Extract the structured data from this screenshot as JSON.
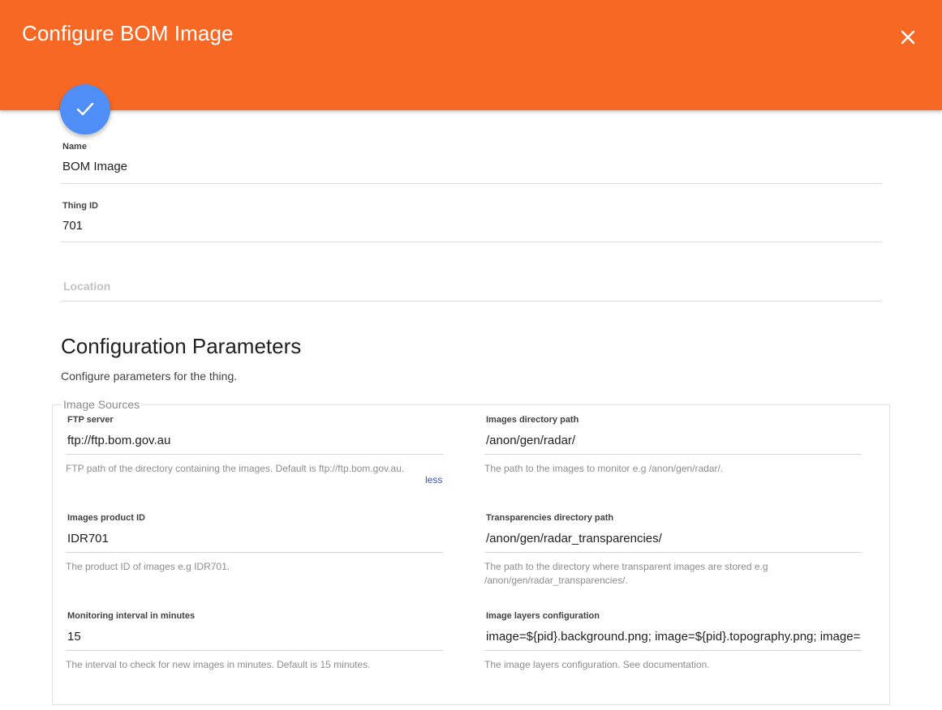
{
  "theme": {
    "header_color": "#f76825",
    "fab_color": "#4f8ef7"
  },
  "header": {
    "title": "Configure BOM Image",
    "close_icon": "close-icon"
  },
  "fab": {
    "icon": "check-icon"
  },
  "form": {
    "name": {
      "label": "Name",
      "value": "BOM Image"
    },
    "thing_id": {
      "label": "Thing ID",
      "value": "701"
    },
    "location": {
      "placeholder": "Location"
    }
  },
  "config": {
    "title": "Configuration Parameters",
    "subtitle": "Configure parameters for the thing.",
    "group_label": "Image Sources",
    "params": [
      {
        "label": "FTP server",
        "value": "ftp://ftp.bom.gov.au",
        "hint": "FTP path of the directory containing the images. Default is ftp://ftp.bom.gov.au.",
        "toggle": "less"
      },
      {
        "label": "Images directory path",
        "value": "/anon/gen/radar/",
        "hint": "The path to the images to monitor e.g /anon/gen/radar/."
      },
      {
        "label": "Images product ID",
        "value": "IDR701",
        "hint": "The product ID of images e.g IDR701."
      },
      {
        "label": "Transparencies directory path",
        "value": "/anon/gen/radar_transparencies/",
        "hint": "The path to the directory where transparent images are stored e.g /anon/gen/radar_transparencies/."
      },
      {
        "label": "Monitoring interval in minutes",
        "value": "15",
        "hint": "The interval to check for new images in minutes. Default is 15 minutes."
      },
      {
        "label": "Image layers configuration",
        "value": "image=${pid}.background.png; image=${pid}.topography.png; image=${pid}.locations.png",
        "hint": "The image layers configuration. See documentation."
      }
    ]
  }
}
